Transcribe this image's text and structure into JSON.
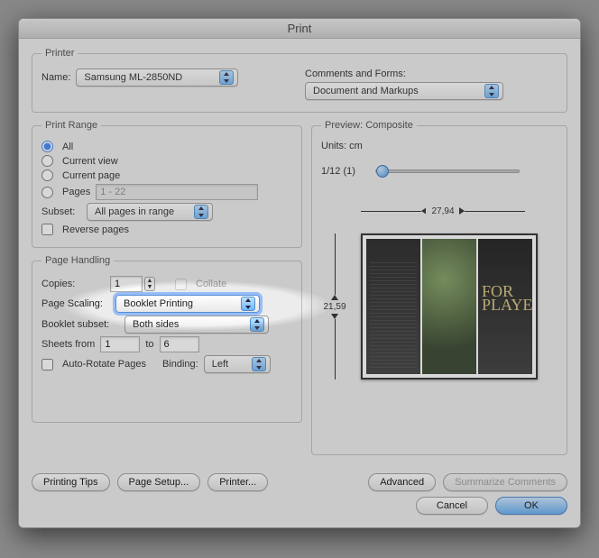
{
  "window": {
    "title": "Print"
  },
  "printer": {
    "legend": "Printer",
    "name_label": "Name:",
    "name_value": "Samsung ML-2850ND",
    "comments_label": "Comments and Forms:",
    "comments_value": "Document and Markups"
  },
  "print_range": {
    "legend": "Print Range",
    "all": "All",
    "current_view": "Current view",
    "current_page": "Current page",
    "pages_label": "Pages",
    "pages_value": "1 - 22",
    "subset_label": "Subset:",
    "subset_value": "All pages in range",
    "reverse": "Reverse pages"
  },
  "page_handling": {
    "legend": "Page Handling",
    "copies_label": "Copies:",
    "copies_value": "1",
    "collate": "Collate",
    "scaling_label": "Page Scaling:",
    "scaling_value": "Booklet Printing",
    "booklet_subset_label": "Booklet subset:",
    "booklet_subset_value": "Both sides",
    "sheets_from_label": "Sheets from",
    "sheets_from": "1",
    "sheets_to_label": "to",
    "sheets_to": "6",
    "auto_rotate": "Auto-Rotate Pages",
    "binding_label": "Binding:",
    "binding_value": "Left"
  },
  "preview": {
    "legend": "Preview: Composite",
    "units": "Units: cm",
    "page_indicator": "1/12 (1)",
    "width": "27,94",
    "height": "21,59",
    "panel3_text": "FOR\nPLAYERS"
  },
  "buttons": {
    "tips": "Printing Tips",
    "page_setup": "Page Setup...",
    "printer": "Printer...",
    "advanced": "Advanced",
    "summarize": "Summarize Comments",
    "cancel": "Cancel",
    "ok": "OK"
  }
}
